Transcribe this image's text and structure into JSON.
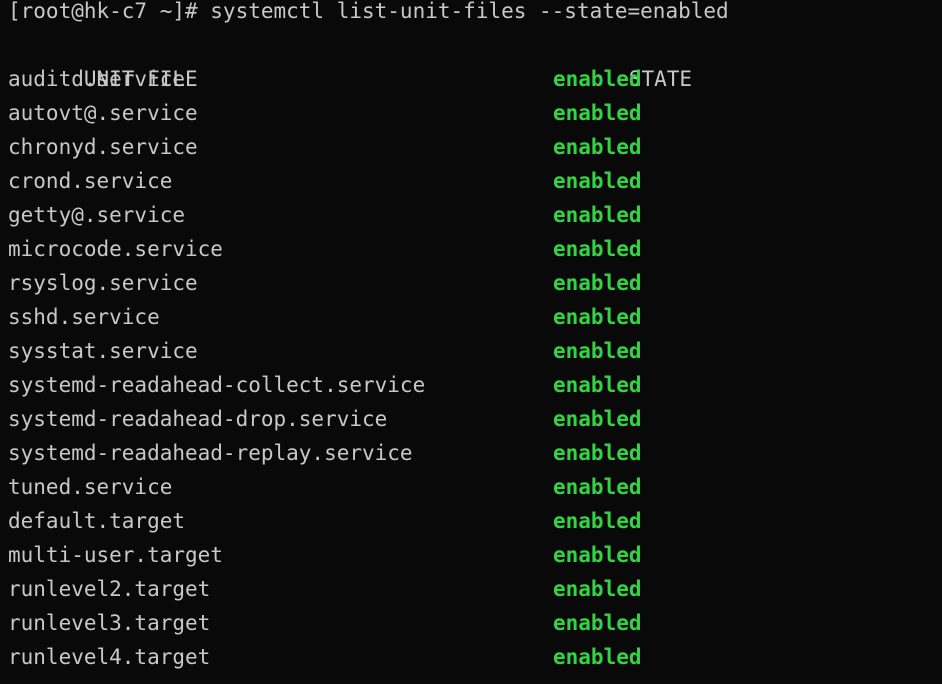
{
  "terminal": {
    "colors": {
      "background": "#090909",
      "foreground": "#c8c8c8",
      "state_enabled": "#33d343"
    },
    "prompt": "[root@hk-c7 ~]# systemctl list-unit-files --state=enabled",
    "header": {
      "unit_file": "UNIT FILE",
      "state": "STATE"
    },
    "rows": [
      {
        "unit": "auditd.service",
        "state": "enabled"
      },
      {
        "unit": "autovt@.service",
        "state": "enabled"
      },
      {
        "unit": "chronyd.service",
        "state": "enabled"
      },
      {
        "unit": "crond.service",
        "state": "enabled"
      },
      {
        "unit": "getty@.service",
        "state": "enabled"
      },
      {
        "unit": "microcode.service",
        "state": "enabled"
      },
      {
        "unit": "rsyslog.service",
        "state": "enabled"
      },
      {
        "unit": "sshd.service",
        "state": "enabled"
      },
      {
        "unit": "sysstat.service",
        "state": "enabled"
      },
      {
        "unit": "systemd-readahead-collect.service",
        "state": "enabled"
      },
      {
        "unit": "systemd-readahead-drop.service",
        "state": "enabled"
      },
      {
        "unit": "systemd-readahead-replay.service",
        "state": "enabled"
      },
      {
        "unit": "tuned.service",
        "state": "enabled"
      },
      {
        "unit": "default.target",
        "state": "enabled"
      },
      {
        "unit": "multi-user.target",
        "state": "enabled"
      },
      {
        "unit": "runlevel2.target",
        "state": "enabled"
      },
      {
        "unit": "runlevel3.target",
        "state": "enabled"
      },
      {
        "unit": "runlevel4.target",
        "state": "enabled"
      }
    ]
  }
}
